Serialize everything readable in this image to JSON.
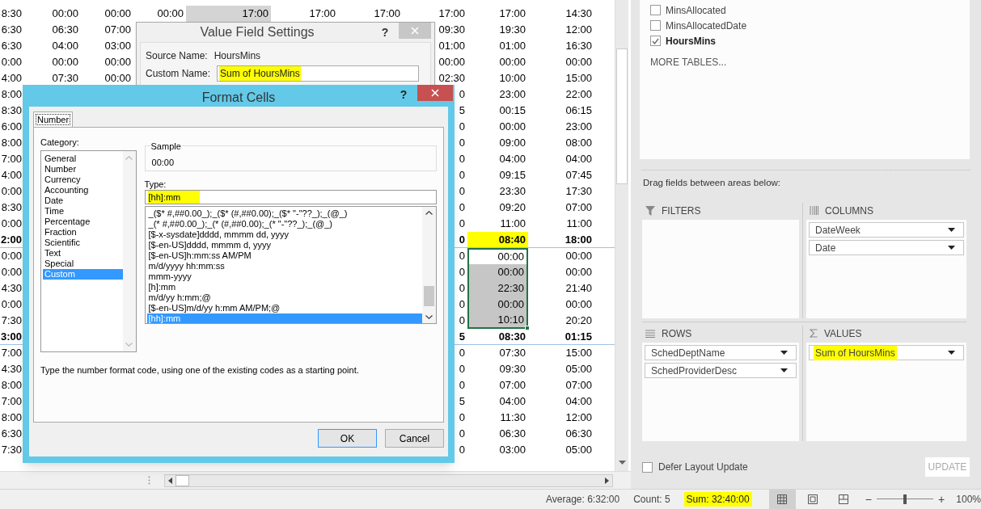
{
  "sheet": {
    "rows": [
      {
        "cells": [
          "8:30",
          "00:00",
          "00:00",
          "00:00",
          {
            "text": "17:00",
            "shaded": true
          },
          "17:00",
          "17:00",
          "17:00",
          "17:00",
          "14:30"
        ]
      },
      {
        "cells": [
          "6:30",
          "06:30",
          "07:00",
          null,
          null,
          null,
          null,
          "09:30",
          "19:30",
          "12:00"
        ]
      },
      {
        "cells": [
          "6:30",
          "04:00",
          "03:00",
          null,
          null,
          null,
          null,
          "01:00",
          "01:00",
          "16:30"
        ]
      },
      {
        "cells": [
          "0:00",
          "00:00",
          "00:00",
          null,
          null,
          null,
          null,
          "00:00",
          "00:00",
          "00:00"
        ]
      },
      {
        "cells": [
          "4:00",
          "07:30",
          "00:00",
          null,
          null,
          null,
          null,
          "02:30",
          "10:00",
          "15:00"
        ]
      },
      {
        "cells": [
          "8:00",
          null,
          null,
          null,
          null,
          null,
          null,
          "0",
          "23:00",
          "22:00"
        ]
      },
      {
        "cells": [
          "8:30",
          null,
          null,
          null,
          null,
          null,
          null,
          "5",
          "00:15",
          "06:15"
        ]
      },
      {
        "cells": [
          "6:00",
          null,
          null,
          null,
          null,
          null,
          null,
          "0",
          "00:00",
          "23:00"
        ]
      },
      {
        "cells": [
          "8:00",
          null,
          null,
          null,
          null,
          null,
          null,
          "0",
          "09:00",
          "08:00"
        ]
      },
      {
        "cells": [
          "7:00",
          null,
          null,
          null,
          null,
          null,
          null,
          "0",
          "04:00",
          "04:00"
        ]
      },
      {
        "cells": [
          "4:00",
          null,
          null,
          null,
          null,
          null,
          null,
          "0",
          "09:15",
          "07:45"
        ]
      },
      {
        "cells": [
          "0:00",
          null,
          null,
          null,
          null,
          null,
          null,
          "0",
          "23:30",
          "17:30"
        ]
      },
      {
        "cells": [
          "8:30",
          null,
          null,
          null,
          null,
          null,
          null,
          "0",
          "09:20",
          "07:00"
        ]
      },
      {
        "cells": [
          "0:00",
          null,
          null,
          null,
          null,
          null,
          null,
          "0",
          "11:00",
          "11:00"
        ]
      },
      {
        "total": true,
        "cells": [
          "2:00",
          null,
          null,
          null,
          null,
          null,
          null,
          "0",
          {
            "text": "08:40",
            "highlighted": true
          },
          "18:00"
        ]
      },
      {
        "cells": [
          "0:00",
          null,
          null,
          null,
          null,
          null,
          null,
          "0",
          {
            "text": "00:00",
            "selected": true,
            "active": true
          },
          "00:00"
        ]
      },
      {
        "cells": [
          "0:00",
          null,
          null,
          null,
          null,
          null,
          null,
          "0",
          {
            "text": "00:00",
            "selected": true,
            "active": false
          },
          "00:00"
        ]
      },
      {
        "cells": [
          "4:30",
          null,
          null,
          null,
          null,
          null,
          null,
          "0",
          {
            "text": "22:30",
            "selected": true,
            "active": false
          },
          "21:40"
        ]
      },
      {
        "cells": [
          "0:00",
          null,
          null,
          null,
          null,
          null,
          null,
          "0",
          {
            "text": "00:00",
            "selected": true,
            "active": false
          },
          "00:00"
        ]
      },
      {
        "cells": [
          "7:30",
          null,
          null,
          null,
          null,
          null,
          null,
          "0",
          {
            "text": "10:10",
            "selected": true,
            "active": false
          },
          "20:20"
        ]
      },
      {
        "total": true,
        "cells": [
          "3:00",
          null,
          null,
          null,
          null,
          null,
          null,
          "5",
          "08:30",
          "01:15"
        ]
      },
      {
        "cells": [
          "7:00",
          null,
          null,
          null,
          null,
          null,
          null,
          "0",
          "07:30",
          "15:00"
        ]
      },
      {
        "cells": [
          "4:30",
          null,
          null,
          null,
          null,
          null,
          null,
          "0",
          "09:30",
          "05:00"
        ]
      },
      {
        "cells": [
          "8:00",
          null,
          null,
          null,
          null,
          null,
          null,
          "0",
          "07:00",
          "07:00"
        ]
      },
      {
        "cells": [
          "7:00",
          null,
          null,
          null,
          null,
          null,
          null,
          "5",
          "04:00",
          "04:00"
        ]
      },
      {
        "cells": [
          "8:00",
          null,
          null,
          null,
          null,
          null,
          null,
          "0",
          "11:30",
          "12:00"
        ]
      },
      {
        "cells": [
          "6:30",
          null,
          null,
          null,
          null,
          null,
          null,
          "0",
          "06:30",
          "06:30"
        ]
      },
      {
        "cells": [
          "7:30",
          null,
          null,
          null,
          null,
          null,
          null,
          "0",
          "03:00",
          "05:00"
        ]
      }
    ]
  },
  "value_field_dialog": {
    "title": "Value Field Settings",
    "help": "?",
    "source_label": "Source Name:",
    "source_value": "HoursMins",
    "custom_label": "Custom Name:",
    "custom_value": {
      "text": "Sum of HoursMins",
      "highlighted": true
    }
  },
  "format_cells_dialog": {
    "title": "Format Cells",
    "help": "?",
    "tabs": [
      {
        "label": "Number",
        "selected": true
      }
    ],
    "category_label": "Category:",
    "categories": [
      {
        "label": "General",
        "selected": false
      },
      {
        "label": "Number",
        "selected": false
      },
      {
        "label": "Currency",
        "selected": false
      },
      {
        "label": "Accounting",
        "selected": false
      },
      {
        "label": "Date",
        "selected": false
      },
      {
        "label": "Time",
        "selected": false
      },
      {
        "label": "Percentage",
        "selected": false
      },
      {
        "label": "Fraction",
        "selected": false
      },
      {
        "label": "Scientific",
        "selected": false
      },
      {
        "label": "Text",
        "selected": false
      },
      {
        "label": "Special",
        "selected": false
      },
      {
        "label": "Custom",
        "selected": true
      }
    ],
    "sample_label": "Sample",
    "sample_value": "00:00",
    "type_label": "Type:",
    "type_value": {
      "text": "[hh]:mm",
      "highlighted": true
    },
    "formats": [
      {
        "label": "_($* #,##0.00_);_($* (#,##0.00);_($* \"-\"??_);_(@_)",
        "selected": false
      },
      {
        "label": "_(* #,##0.00_);_(* (#,##0.00);_(* \"-\"??_);_(@_)",
        "selected": false
      },
      {
        "label": "[$-x-sysdate]dddd, mmmm dd, yyyy",
        "selected": false
      },
      {
        "label": "[$-en-US]dddd, mmmm d, yyyy",
        "selected": false
      },
      {
        "label": "[$-en-US]h:mm:ss AM/PM",
        "selected": false
      },
      {
        "label": "m/d/yyyy hh:mm:ss",
        "selected": false
      },
      {
        "label": "mmm-yyyy",
        "selected": false
      },
      {
        "label": "[h]:mm",
        "selected": false
      },
      {
        "label": "m/d/yy h:mm;@",
        "selected": false
      },
      {
        "label": "[$-en-US]m/d/yy h:mm AM/PM;@",
        "selected": false
      },
      {
        "label": "[hh]:mm",
        "selected": true
      }
    ],
    "description": "Type the number format code, using one of the existing codes as a starting point.",
    "buttons": [
      {
        "label": "OK",
        "default": true
      },
      {
        "label": "Cancel",
        "default": false
      }
    ]
  },
  "field_list": {
    "fields": [
      {
        "label": "MinsAllocated",
        "checked": false
      },
      {
        "label": "MinsAllocatedDate",
        "checked": false
      },
      {
        "label": "HoursMins",
        "checked": true
      }
    ],
    "more_tables": "MORE TABLES..."
  },
  "areas_hint": "Drag fields between areas below:",
  "areas": [
    {
      "kind": "filters",
      "title": "FILTERS"
    },
    {
      "kind": "columns",
      "title": "COLUMNS",
      "items": [
        {
          "label": "DateWeek",
          "highlighted": false
        },
        {
          "label": "Date",
          "highlighted": false
        }
      ]
    },
    {
      "kind": "rows",
      "title": "ROWS",
      "items": [
        {
          "label": "SchedDeptName",
          "highlighted": false
        },
        {
          "label": "SchedProviderDesc",
          "highlighted": false
        }
      ]
    },
    {
      "kind": "values",
      "title": "VALUES",
      "items": [
        {
          "label": "Sum of HoursMins",
          "highlighted": true
        }
      ]
    }
  ],
  "defer_update": {
    "label": "Defer Layout Update",
    "checked": false
  },
  "update_button": {
    "label": "UPDATE",
    "disabled": true
  },
  "status_bar": {
    "average": "Average: 6:32:00",
    "count": "Count: 5",
    "sum": {
      "text": "Sum: 32:40:00",
      "highlighted": true
    },
    "views": [
      {
        "kind": "normal",
        "selected": true
      },
      {
        "kind": "page_layout",
        "selected": false
      },
      {
        "kind": "page_break",
        "selected": false
      }
    ],
    "zoom": {
      "out": "−",
      "in": "+",
      "level": 0.5,
      "reading": "100%"
    }
  }
}
